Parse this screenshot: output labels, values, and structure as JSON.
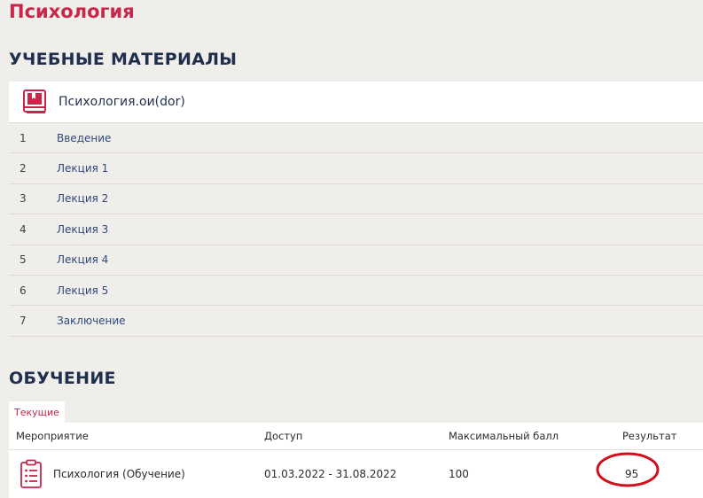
{
  "page": {
    "title": "Психология"
  },
  "materials": {
    "title": "УЧЕБНЫЕ МАТЕРИАЛЫ",
    "course_name": "Психология.ои(dor)",
    "lessons": [
      {
        "num": "1",
        "label": "Введение"
      },
      {
        "num": "2",
        "label": "Лекция 1"
      },
      {
        "num": "3",
        "label": "Лекция 2"
      },
      {
        "num": "4",
        "label": "Лекция 3"
      },
      {
        "num": "5",
        "label": "Лекция 4"
      },
      {
        "num": "6",
        "label": "Лекция 5"
      },
      {
        "num": "7",
        "label": "Заключение"
      }
    ]
  },
  "training": {
    "title": "ОБУЧЕНИЕ",
    "tab_current": "Текущие",
    "headers": {
      "event": "Мероприятие",
      "access": "Доступ",
      "max_score": "Максимальный балл",
      "result": "Результат"
    },
    "rows": [
      {
        "event": "Психология (Обучение)",
        "access": "01.03.2022 - 31.08.2022",
        "max_score": "100",
        "result": "95"
      }
    ]
  },
  "colors": {
    "accent": "#c8264a",
    "heading": "#1f2f4d",
    "link": "#2f4a7a",
    "annotation": "#d0101c"
  },
  "icons": {
    "course": "book-icon",
    "event": "clipboard-list-icon"
  }
}
